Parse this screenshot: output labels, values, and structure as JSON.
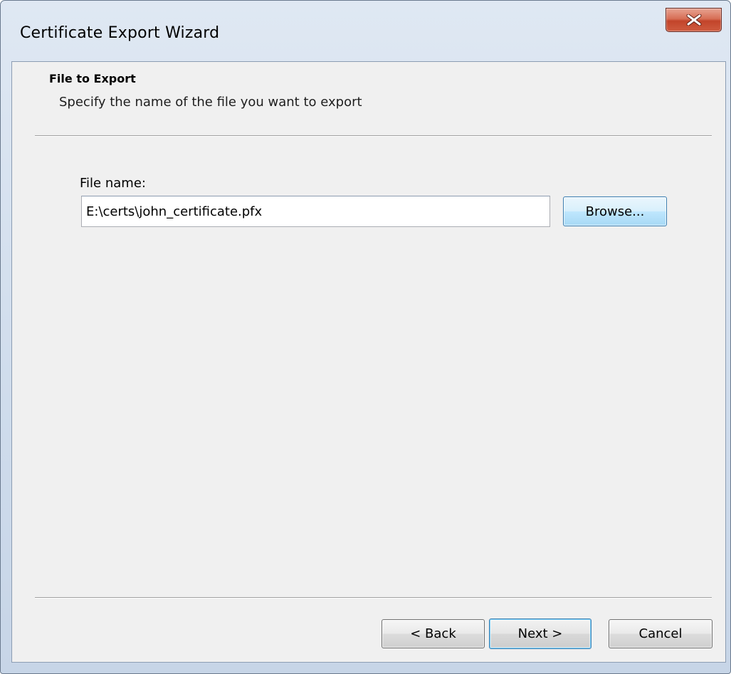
{
  "window": {
    "title": "Certificate Export Wizard"
  },
  "header": {
    "title": "File to Export",
    "subtitle": "Specify the name of the file you want to export"
  },
  "form": {
    "file_name_label": "File name:",
    "file_name_value": "E:\\certs\\john_certificate.pfx",
    "browse_label": "Browse..."
  },
  "footer": {
    "back_label": "< Back",
    "next_label": "Next >",
    "cancel_label": "Cancel"
  },
  "icons": {
    "close": "close-icon"
  },
  "colors": {
    "close_button": "#c7452b",
    "default_button_border": "#3c7fb1",
    "dialog_background": "#f0f0f0"
  }
}
